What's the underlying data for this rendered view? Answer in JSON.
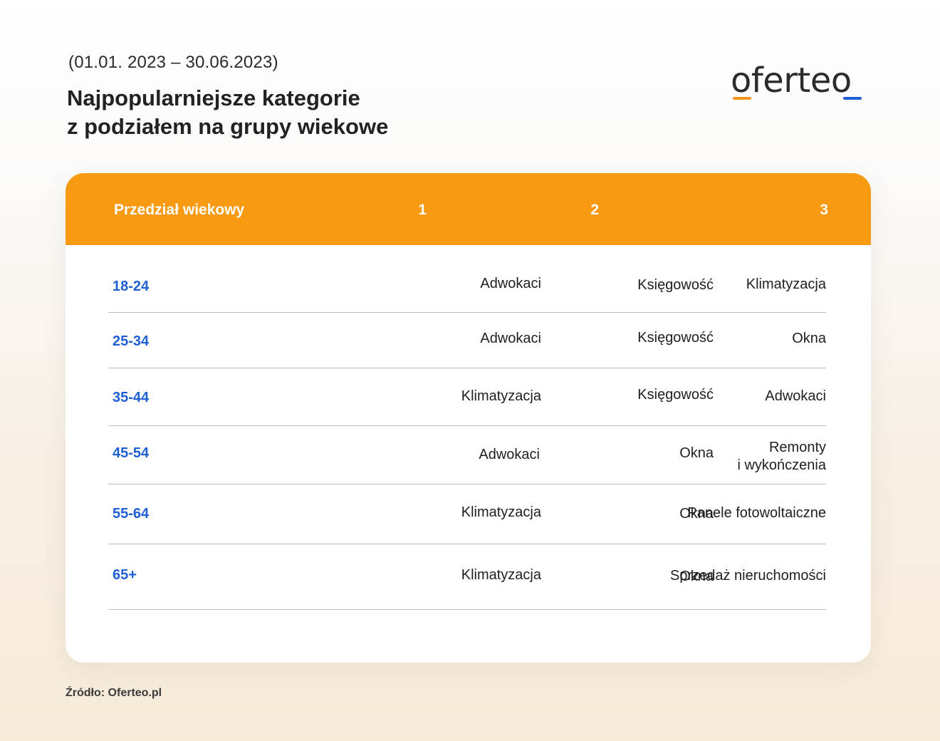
{
  "header": {
    "date_range": "(01.01. 2023 – 30.06.2023)",
    "title_line1": "Najpopularniejsze kategorie",
    "title_line2": "z podziałem na grupy wiekowe",
    "logo_text": "oferteo"
  },
  "colors": {
    "accent_orange": "#f99a13",
    "age_blue": "#1f5fd6",
    "logo_blue": "#1f5fd6",
    "logo_orange": "#f7941d"
  },
  "table": {
    "columns": [
      "Przedział wiekowy",
      "1",
      "2",
      "3"
    ],
    "rows": [
      {
        "age": "18-24",
        "c1": "Adwokaci",
        "c2": "Księgowość",
        "c3_line1": "Klimatyzacja",
        "c3_line2": ""
      },
      {
        "age": "25-34",
        "c1": "Adwokaci",
        "c2": "Księgowość",
        "c3_line1": "Okna",
        "c3_line2": ""
      },
      {
        "age": "35-44",
        "c1": "Klimatyzacja",
        "c2": "Księgowość",
        "c3_line1": "Adwokaci",
        "c3_line2": ""
      },
      {
        "age": "45-54",
        "c1": "Adwokaci",
        "c2": "Okna",
        "c3_line1": "Remonty",
        "c3_line2": "i wykończenia"
      },
      {
        "age": "55-64",
        "c1": "Klimatyzacja",
        "c2": "Okna",
        "c3_line1": "Panele fotowoltaiczne",
        "c3_line2": ""
      },
      {
        "age": "65+",
        "c1": "Klimatyzacja",
        "c2": "Okna",
        "c3_line1": "Sprzedaż nieruchomości",
        "c3_line2": ""
      }
    ]
  },
  "footer": {
    "source": "Źródło: Oferteo.pl"
  }
}
